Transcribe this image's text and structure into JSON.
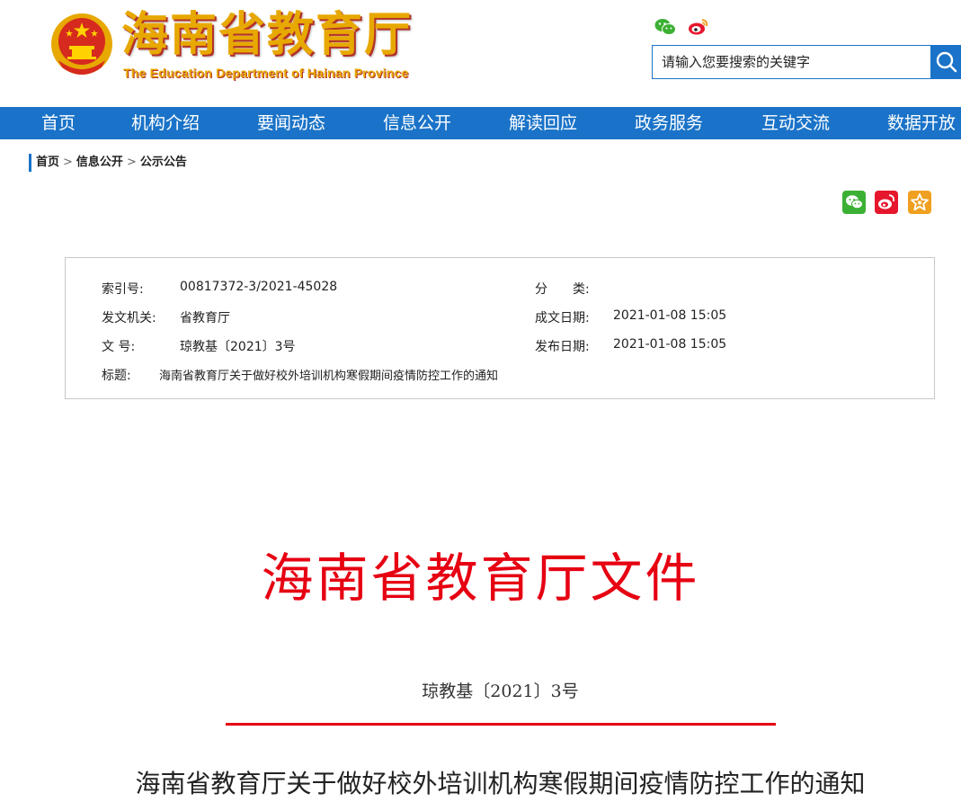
{
  "header": {
    "site_title": "海南省教育厅",
    "site_subtitle": "The Education Department of Hainan Province",
    "search_placeholder": "请输入您要搜索的关键字"
  },
  "nav": {
    "items": [
      "首页",
      "机构介绍",
      "要闻动态",
      "信息公开",
      "解读回应",
      "政务服务",
      "互动交流",
      "数据开放"
    ]
  },
  "breadcrumb": {
    "home": "首页",
    "sep": ">",
    "level1": "信息公开",
    "level2": "公示公告"
  },
  "meta": {
    "index_label": "索引号:",
    "index_value": "00817372-3/2021-45028",
    "category_label": "分　　类:",
    "category_value": "",
    "issuer_label": "发文机关:",
    "issuer_value": "省教育厅",
    "created_label": "成文日期:",
    "created_value": "2021-01-08 15:05",
    "docno_label": "文 号:",
    "docno_value": "琼教基〔2021〕3号",
    "published_label": "发布日期:",
    "published_value": "2021-01-08 15:05",
    "title_label": "标题:",
    "title_value": "海南省教育厅关于做好校外培训机构寒假期间疫情防控工作的通知"
  },
  "document": {
    "header": "海南省教育厅文件",
    "number": "琼教基〔2021〕3号",
    "title": "海南省教育厅关于做好校外培训机构寒假期间疫情防控工作的通知"
  },
  "colors": {
    "nav_blue": "#1a73c8",
    "doc_red": "#e60012",
    "title_gold": "#e7a800",
    "wechat_green": "#3cb034",
    "weibo_red": "#e6162d",
    "favorite_orange": "#f0a020"
  },
  "icons": {
    "emblem": "national-emblem-icon",
    "wechat": "wechat-icon",
    "weibo": "weibo-icon",
    "favorite": "star-icon",
    "search": "search-icon"
  }
}
